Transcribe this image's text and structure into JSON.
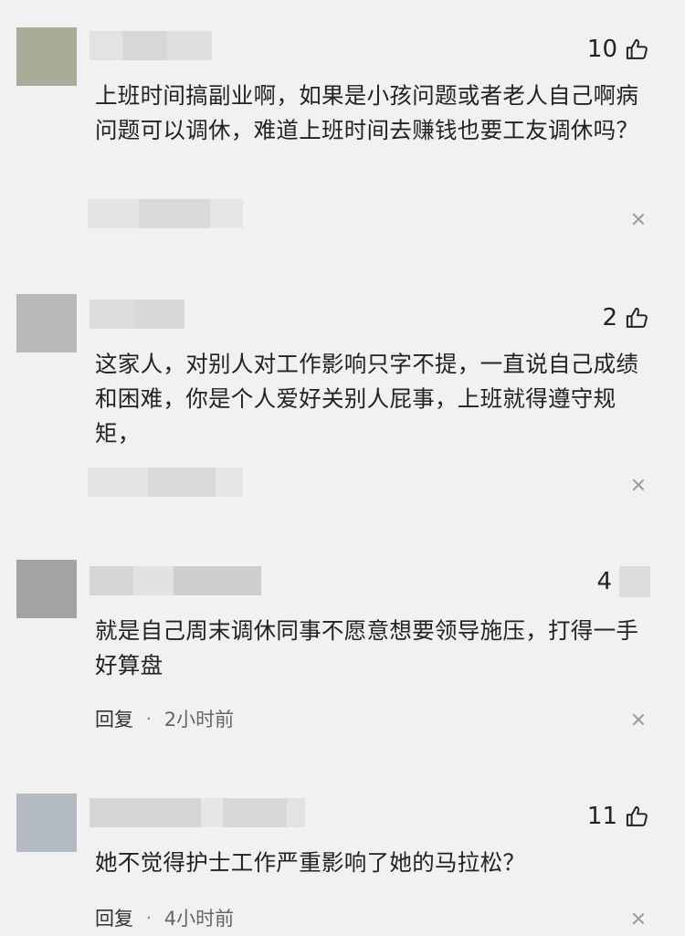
{
  "comments": [
    {
      "likes": "10",
      "text": "上班时间搞副业啊，如果是小孩问题或者老人自己啊病问题可以调休，难道上班时间去赚钱也要工友调休吗？",
      "avatar_color": "#a9ab99"
    },
    {
      "likes": "2",
      "text": "这家人，对别人对工作影响只字不提，一直说自己成绩和困难，你是个人爱好关别人屁事，上班就得遵守规矩，",
      "avatar_color": "#b9b9b9"
    },
    {
      "likes": "4",
      "text": "就是自己周末调休同事不愿意想要领导施压，打得一手好算盘",
      "reply": "回复",
      "separator": "·",
      "time": "2小时前",
      "avatar_color": "#a3a3a1"
    },
    {
      "likes": "11",
      "text": "她不觉得护士工作严重影响了她的马拉松？",
      "reply": "回复",
      "separator": "·",
      "time": "4小时前",
      "avatar_color": "#b4bac2"
    }
  ],
  "icons": {
    "like": "thumbs-up-icon",
    "close": "close-icon"
  }
}
